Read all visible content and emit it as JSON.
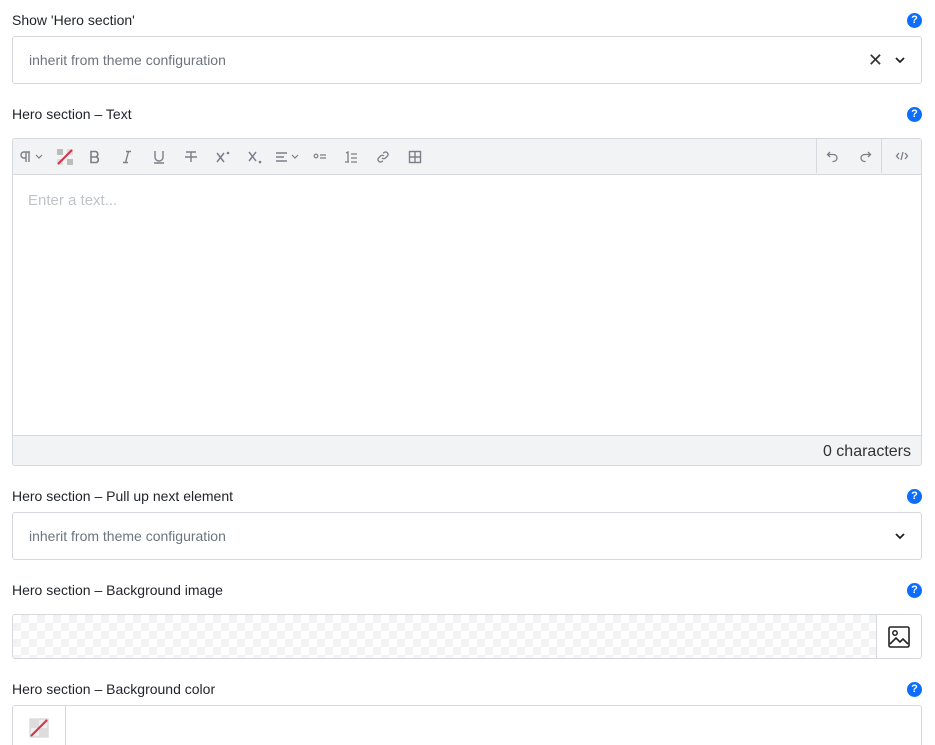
{
  "fields": {
    "show_hero": {
      "label": "Show 'Hero section'",
      "value": "inherit from theme configuration"
    },
    "hero_text": {
      "label": "Hero section – Text",
      "placeholder": "Enter a text...",
      "char_count": "0 characters"
    },
    "pull_up": {
      "label": "Hero section – Pull up next element",
      "value": "inherit from theme configuration"
    },
    "bg_image": {
      "label": "Hero section – Background image"
    },
    "bg_color": {
      "label": "Hero section – Background color"
    }
  },
  "help_glyph": "?",
  "clear_glyph": "✕",
  "colors": {
    "help": "#0d6efd",
    "border": "#d5d9de",
    "toolbar_bg": "#f1f3f5",
    "icon": "#7a8088"
  }
}
